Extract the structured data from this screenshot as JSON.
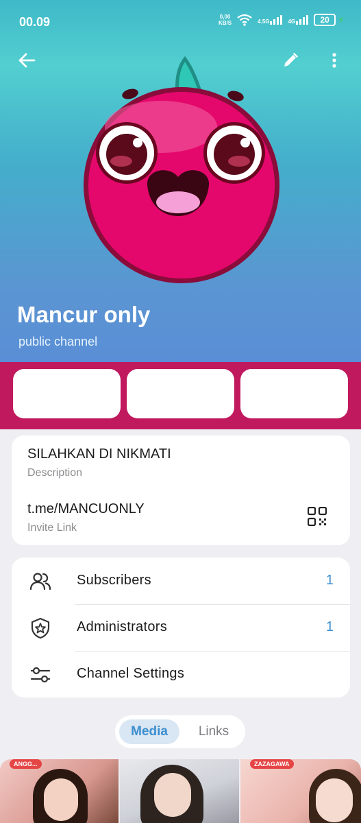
{
  "status_bar": {
    "time": "00.09",
    "net_speed_value": "0,00",
    "net_speed_unit": "KB/S",
    "sig1_label": "4.5G",
    "sig2_label": "4G",
    "battery": "20"
  },
  "header": {
    "channel_name": "Mancur only",
    "channel_type": "public channel"
  },
  "info": {
    "description_value": "SILAHKAN DI NIKMATI",
    "description_label": "Description",
    "link_value": "t.me/MANCUONLY",
    "link_label": "Invite Link"
  },
  "list": {
    "subscribers_label": "Subscribers",
    "subscribers_count": "1",
    "admins_label": "Administrators",
    "admins_count": "1",
    "settings_label": "Channel Settings"
  },
  "tabs": {
    "media": "Media",
    "links": "Links"
  },
  "media_thumbs": [
    {
      "banner": "ANGG..."
    },
    {
      "banner": ""
    },
    {
      "banner": "ZAZAGAWA"
    }
  ],
  "colors": {
    "accent": "#3d8fcf",
    "action_strip": "#c0195e",
    "avatar_face": "#e5086c"
  }
}
